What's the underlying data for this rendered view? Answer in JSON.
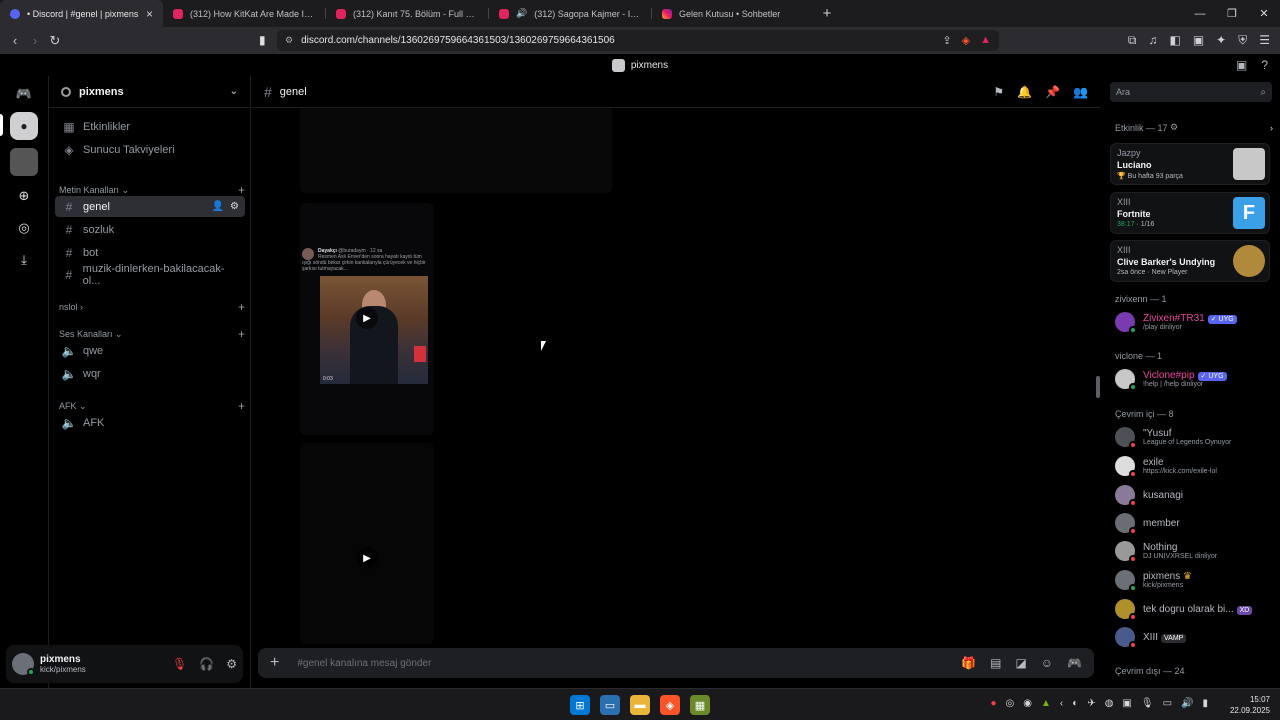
{
  "browser": {
    "tabs": [
      {
        "title": "• Discord | #genel | pixmens",
        "icon": "discord-icon",
        "active": true
      },
      {
        "title": "(312) How KitKat Are Made In a Facto",
        "icon": "youtube-icon",
        "active": false
      },
      {
        "title": "(312) Kanıt 75. Bölüm - Full Bölüm - ",
        "icon": "youtube-icon",
        "active": false
      },
      {
        "title": "(312) Sagopa Kajmer - Istakoz 20",
        "icon": "youtube-icon",
        "active": false
      },
      {
        "title": "Gelen Kutusu • Sohbetler",
        "icon": "instagram-icon",
        "active": false
      }
    ],
    "url": "discord.com/channels/1360269759664361503/1360269759664361506"
  },
  "window_title": "pixmens",
  "guild": {
    "name": "pixmens"
  },
  "sidebar": {
    "top_items": [
      {
        "label": "Etkinlikler",
        "icon": "calendar-icon"
      },
      {
        "label": "Sunucu Takviyeleri",
        "icon": "boost-icon"
      }
    ],
    "categories": [
      {
        "label": "Metin Kanalları",
        "channels": [
          "genel",
          "sozluk",
          "bot",
          "muzik-dinlerken-bakilacacak-ol..."
        ]
      },
      {
        "label": "nslol",
        "channels": []
      },
      {
        "label": "Ses Kanalları",
        "channels": [
          "qwe",
          "wqr"
        ]
      },
      {
        "label": "AFK",
        "channels": [
          "AFK"
        ]
      }
    ],
    "selected_channel": "genel"
  },
  "user": {
    "name": "pixmens",
    "status": "kick/pixmens"
  },
  "channel": {
    "name": "genel"
  },
  "search": {
    "placeholder": "Ara"
  },
  "composer": {
    "placeholder": "#genel kanalına mesaj gönder"
  },
  "embed_tweet": {
    "author": "Dayakçı",
    "handle": "@buradaym · 12 sa",
    "text": "Resmen Aslı Enver'den sonra hayatı kaydı tüm ışığı söndü bekar çirkin kankalarıyla çürüyecek ve hiçbir şarkısı tutmayacak...",
    "video_time": "0:03"
  },
  "activity": {
    "header": "Etkinlik — 17",
    "cards": [
      {
        "who": "Jazpy",
        "game": "Luciano",
        "meta": "Bu hafta 93 parça",
        "thumb": "#c8c8c8"
      },
      {
        "who": "XIII",
        "game": "Fortnite",
        "meta_time": "38:17",
        "meta": "1/16",
        "thumb": "#3aa0e8"
      },
      {
        "who": "XIII",
        "game": "Clive Barker's Undying",
        "meta": "2sa önce",
        "meta2": "New Player",
        "thumb": "#b08a3a"
      }
    ]
  },
  "member_groups": [
    {
      "label": "zivixenn — 1",
      "members": [
        {
          "name": "Zivixen#TR31",
          "sub": "/play dinliyor",
          "badge": "✓ UYG",
          "color": "#eb459e",
          "status": "on"
        }
      ]
    },
    {
      "label": "viclone — 1",
      "members": [
        {
          "name": "Viclone#pip",
          "sub": "!help | /help dinliyor",
          "badge": "✓ UYG",
          "color": "#eb459e",
          "status": "on"
        }
      ]
    },
    {
      "label": "Çevrim içi — 8",
      "members": [
        {
          "name": "\"Yusuf",
          "sub": "League of Legends Oynuyor",
          "color": "#b5bac1",
          "status": "dnd"
        },
        {
          "name": "exile",
          "sub": "https://kick.com/exile-lol",
          "color": "#b5bac1",
          "status": "dnd"
        },
        {
          "name": "kusanagi",
          "sub": "",
          "color": "#b5bac1",
          "status": "dnd"
        },
        {
          "name": "member",
          "sub": "",
          "color": "#b5bac1",
          "status": "dnd"
        },
        {
          "name": "Nothing",
          "sub": "DJ UNIVXRSEL dinliyor",
          "color": "#b5bac1",
          "status": "dnd"
        },
        {
          "name": "pixmens",
          "sub": "kick/pixmens",
          "color": "#b5bac1",
          "status": "on"
        },
        {
          "name": "tek dogru olarak bi...",
          "sub": "",
          "badge": "XD",
          "color": "#b5bac1",
          "status": "dnd"
        },
        {
          "name": "XIII",
          "sub": "",
          "badge": "VAMP",
          "color": "#b5bac1",
          "status": "dnd"
        }
      ]
    },
    {
      "label": "Çevrim dışı — 24",
      "members": []
    }
  ],
  "taskbar": {
    "time": "15:07",
    "date": "22.09.2025"
  }
}
